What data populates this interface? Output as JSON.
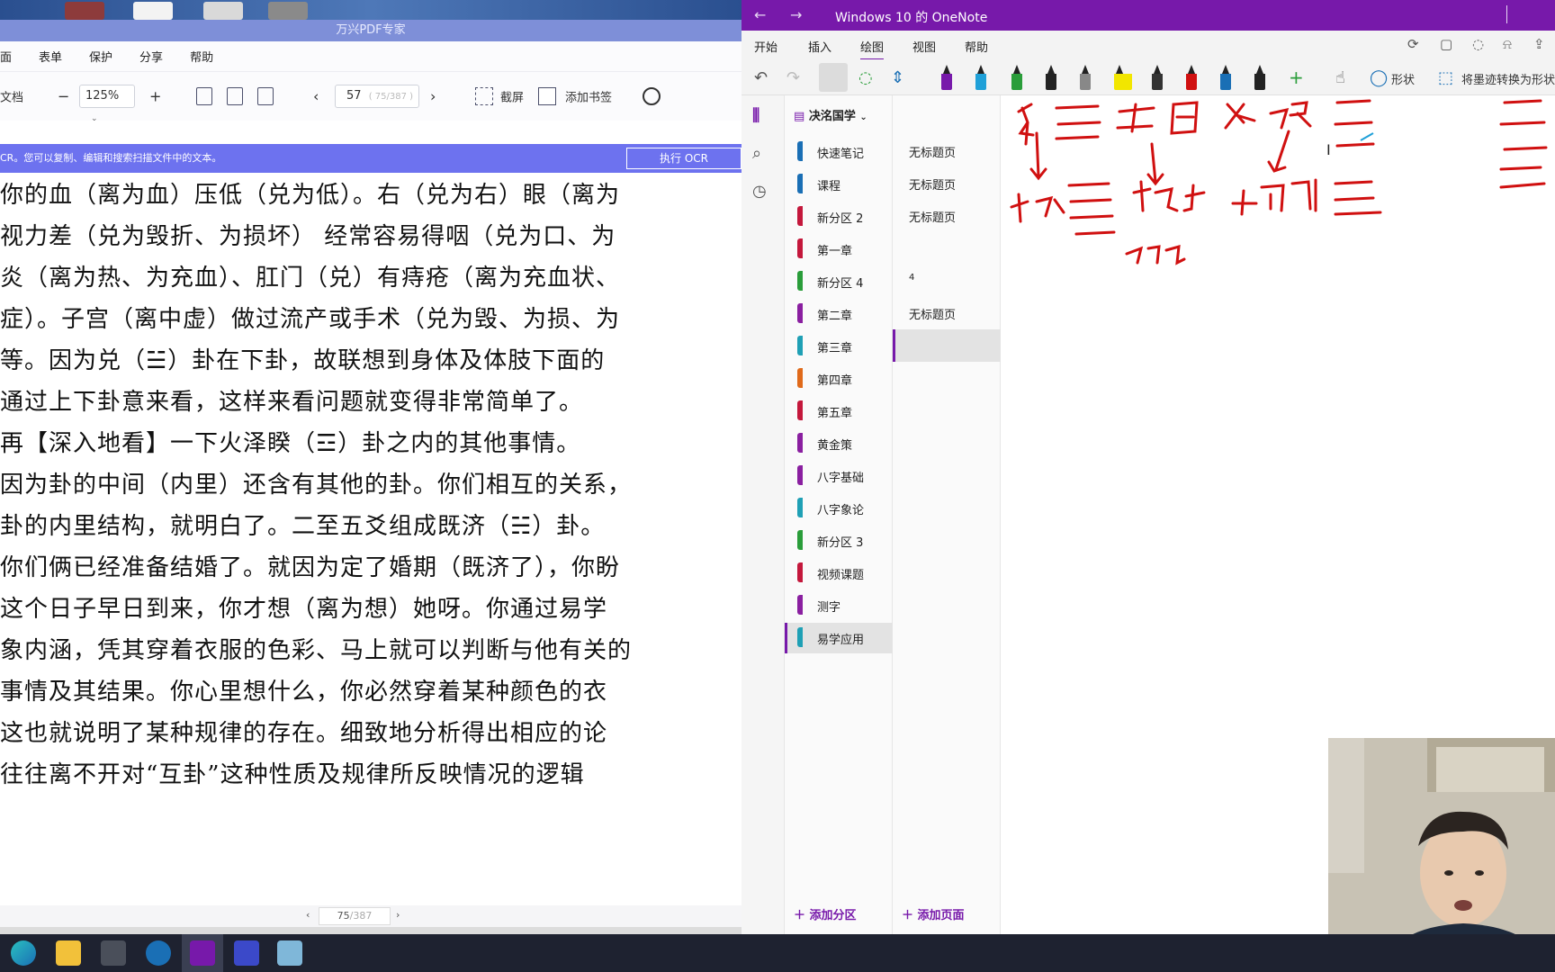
{
  "pdf": {
    "window_title": "万兴PDF专家",
    "menu": [
      "面",
      "表单",
      "保护",
      "分享",
      "帮助"
    ],
    "toolbar": {
      "doc_label": "文档",
      "zoom_minus": "−",
      "zoom_value": "125%",
      "zoom_plus": "+",
      "page_prev": "‹",
      "page_value": "57",
      "page_sub": "( 75/387 )",
      "page_next": "›",
      "screenshot_label": "截屏",
      "bookmark_label": "添加书签"
    },
    "ocr_banner": {
      "text": "CR。您可以复制、编辑和搜索扫描文件中的文本。",
      "button": "执行 OCR"
    },
    "lines": [
      "你的血（离为血）压低（兑为低）。右（兑为右）眼（离为",
      "视力差（兑为毁折、为损坏）  经常容易得咽（兑为口、为",
      "炎（离为热、为充血）、肛门（兑）有痔疮（离为充血状、",
      "症）。子宫（离中虚）做过流产或手术（兑为毁、为损、为",
      "等。因为兑（☱）卦在下卦，故联想到身体及体肢下面的",
      "通过上下卦意来看，这样来看问题就变得非常简单了。",
      "再【深入地看】一下火泽睽（☲）卦之内的其他事情。",
      "因为卦的中间（内里）还含有其他的卦。你们相互的关系，",
      "卦的内里结构，就明白了。二至五爻组成既济（☵）卦。",
      "你们俩已经准备结婚了。就因为定了婚期（既济了），你盼",
      "这个日子早日到来，你才想（离为想）她呀。你通过易学",
      "象内涵，凭其穿着衣服的色彩、马上就可以判断与他有关的",
      "事情及其结果。你心里想什么，你必然穿着某种颜色的衣",
      "这也就说明了某种规律的存在。细致地分析得出相应的论",
      "往往离不开对“互卦”这种性质及规律所反映情况的逻辑"
    ],
    "bottom": {
      "prev": "‹",
      "page": "75",
      "total": "/387",
      "next": "›"
    }
  },
  "onenote": {
    "window_title": "Windows 10 的 OneNote",
    "back": "←",
    "forward": "→",
    "tabs": [
      "开始",
      "插入",
      "绘图",
      "视图",
      "帮助"
    ],
    "active_tab": "绘图",
    "shapes_label": "形状",
    "convert_label": "将墨迹转换为形状",
    "notebook": "决洺国学",
    "sections": [
      {
        "label": "快速笔记",
        "color": "#1a6fb5"
      },
      {
        "label": "课程",
        "color": "#1a6fb5"
      },
      {
        "label": "新分区 2",
        "color": "#c4183c"
      },
      {
        "label": "第一章",
        "color": "#c4183c"
      },
      {
        "label": "新分区 4",
        "color": "#2a9d3a"
      },
      {
        "label": "第二章",
        "color": "#8a1fa0"
      },
      {
        "label": "第三章",
        "color": "#1fa0b5"
      },
      {
        "label": "第四章",
        "color": "#e06a1a"
      },
      {
        "label": "第五章",
        "color": "#c4183c"
      },
      {
        "label": "黄金策",
        "color": "#8a1fa0"
      },
      {
        "label": "八字基础",
        "color": "#8a1fa0"
      },
      {
        "label": "八字象论",
        "color": "#1fa0b5"
      },
      {
        "label": "新分区 3",
        "color": "#2a9d3a"
      },
      {
        "label": "视频课题",
        "color": "#c4183c"
      },
      {
        "label": "测字",
        "color": "#8a1fa0"
      },
      {
        "label": "易学应用",
        "color": "#1fa0b5"
      }
    ],
    "selected_section": "易学应用",
    "pages": [
      "无标题页",
      "无标题页",
      "无标题页",
      "",
      "4",
      "无标题页",
      ""
    ],
    "add_section": "添加分区",
    "add_page": "添加页面",
    "ink_colors": [
      "#7719aa",
      "#d01010",
      "#1a6fb5",
      "#2a9d3a",
      "#222222",
      "#f2e600"
    ]
  }
}
